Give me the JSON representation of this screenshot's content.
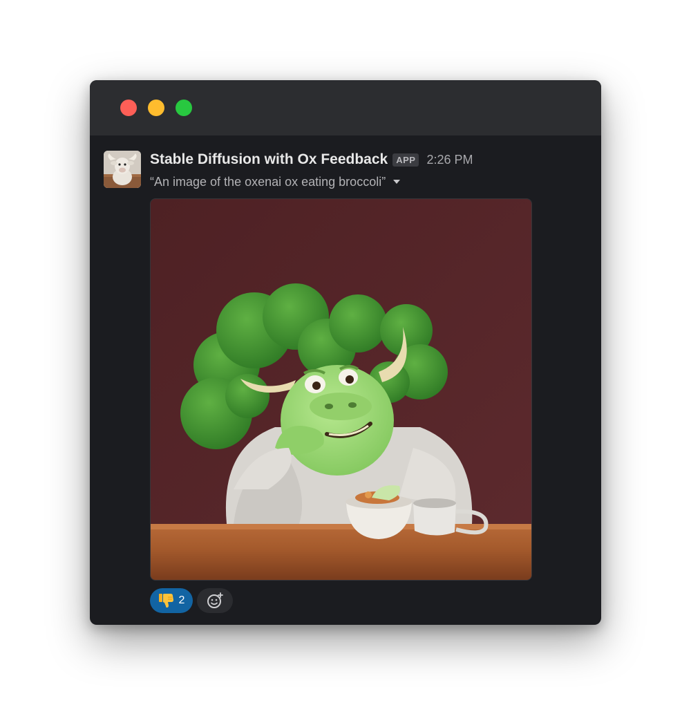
{
  "window": {
    "controls": [
      "close",
      "minimize",
      "zoom"
    ]
  },
  "message": {
    "author": "Stable Diffusion with Ox Feedback",
    "badge": "APP",
    "timestamp": "2:26 PM",
    "caption": "“An image of the oxenai ox eating broccoli”",
    "image": {
      "subject": "green ox with broccoli head eating from a bowl at a wooden table"
    }
  },
  "reactions": [
    {
      "emoji": "thumbs-down",
      "count": "2",
      "active": true
    }
  ],
  "colors": {
    "window_bg": "#1b1c20",
    "titlebar_bg": "#2c2d30",
    "reaction_active": "#1264a3",
    "close": "#fe5f57",
    "minimize": "#febc2e",
    "zoom": "#28c840"
  }
}
